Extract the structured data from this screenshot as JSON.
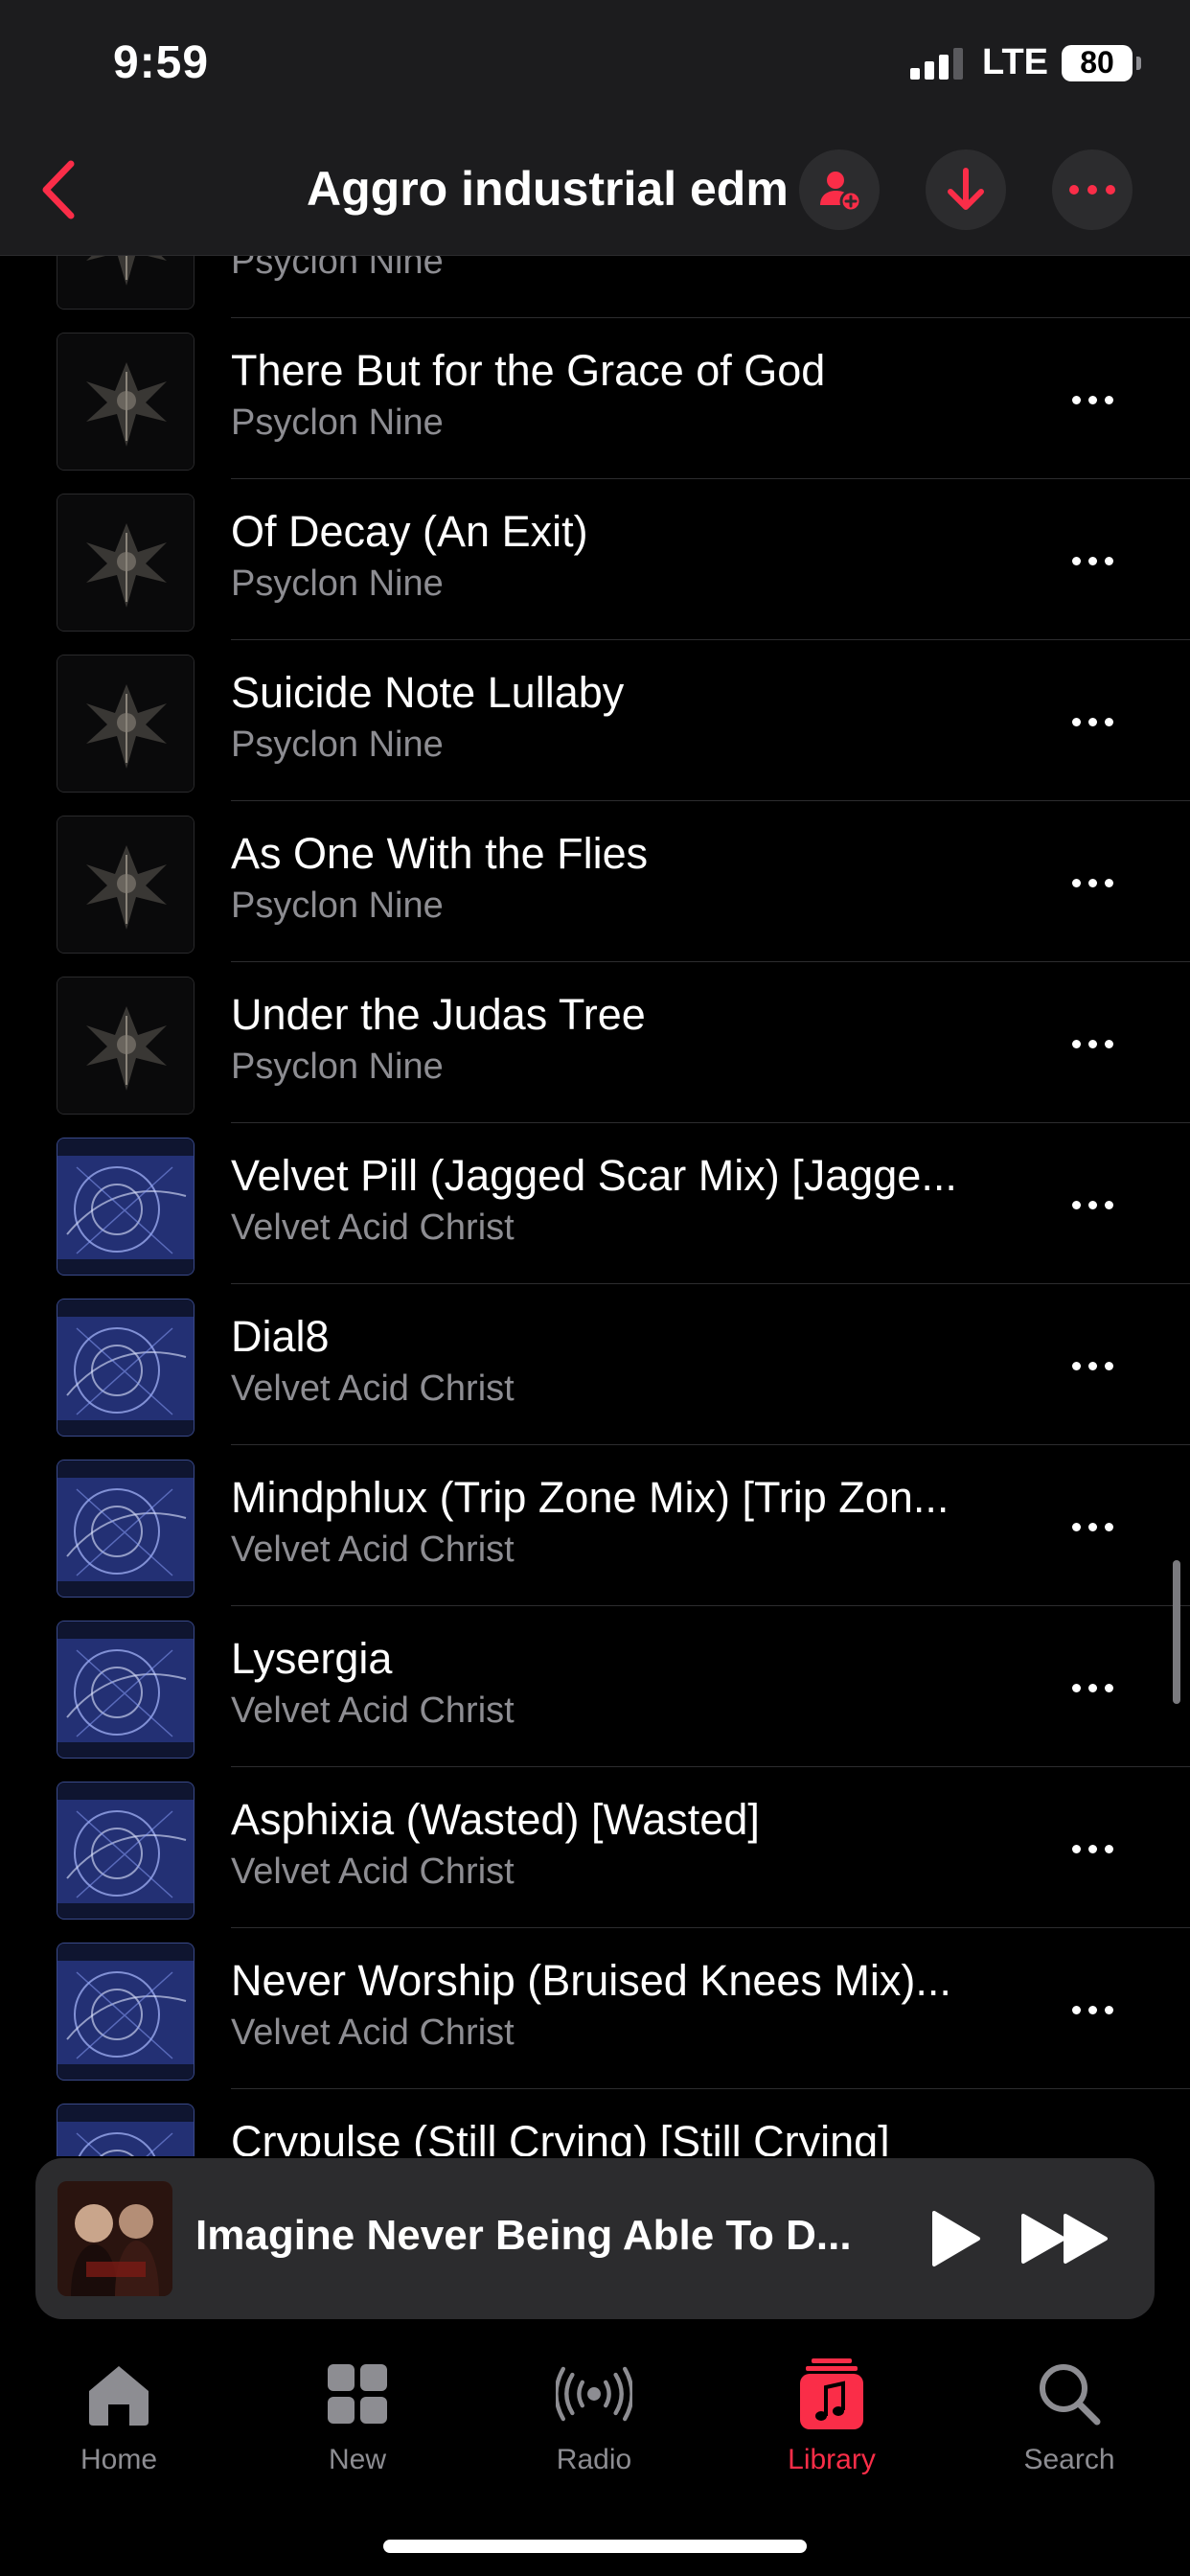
{
  "status_bar": {
    "time": "9:59",
    "network": "LTE",
    "battery": "80"
  },
  "header": {
    "title": "Aggro industrial edm"
  },
  "songs": [
    {
      "title": "",
      "artist": "Psyclon Nine",
      "art": "psyclon"
    },
    {
      "title": "There But for the Grace of God",
      "artist": "Psyclon Nine",
      "art": "psyclon"
    },
    {
      "title": "Of Decay (An Exit)",
      "artist": "Psyclon Nine",
      "art": "psyclon"
    },
    {
      "title": "Suicide Note Lullaby",
      "artist": "Psyclon Nine",
      "art": "psyclon"
    },
    {
      "title": "As One With the Flies",
      "artist": "Psyclon Nine",
      "art": "psyclon"
    },
    {
      "title": "Under the Judas Tree",
      "artist": "Psyclon Nine",
      "art": "psyclon"
    },
    {
      "title": "Velvet Pill (Jagged Scar Mix) [Jagge...",
      "artist": "Velvet Acid Christ",
      "art": "velvet"
    },
    {
      "title": "Dial8",
      "artist": "Velvet Acid Christ",
      "art": "velvet"
    },
    {
      "title": "Mindphlux (Trip Zone Mix) [Trip Zon...",
      "artist": "Velvet Acid Christ",
      "art": "velvet"
    },
    {
      "title": "Lysergia",
      "artist": "Velvet Acid Christ",
      "art": "velvet"
    },
    {
      "title": "Asphixia (Wasted) [Wasted]",
      "artist": "Velvet Acid Christ",
      "art": "velvet"
    },
    {
      "title": "Never Worship (Bruised Knees Mix)...",
      "artist": "Velvet Acid Christ",
      "art": "velvet"
    },
    {
      "title": "Crypulse (Still Crying) [Still Crying]",
      "artist": "",
      "art": "velvet"
    }
  ],
  "now_playing": {
    "title": "Imagine Never Being Able To D..."
  },
  "tabs": [
    {
      "label": "Home",
      "icon": "house-icon"
    },
    {
      "label": "New",
      "icon": "grid-icon"
    },
    {
      "label": "Radio",
      "icon": "radio-waves-icon"
    },
    {
      "label": "Library",
      "icon": "music-note-icon",
      "active": true
    },
    {
      "label": "Search",
      "icon": "search-icon"
    }
  ],
  "colors": {
    "accent": "#fa2d48",
    "secondary_text": "#8d8d92",
    "header_bg": "#1c1c1e",
    "mini_player_bg": "#2c2c2e"
  }
}
